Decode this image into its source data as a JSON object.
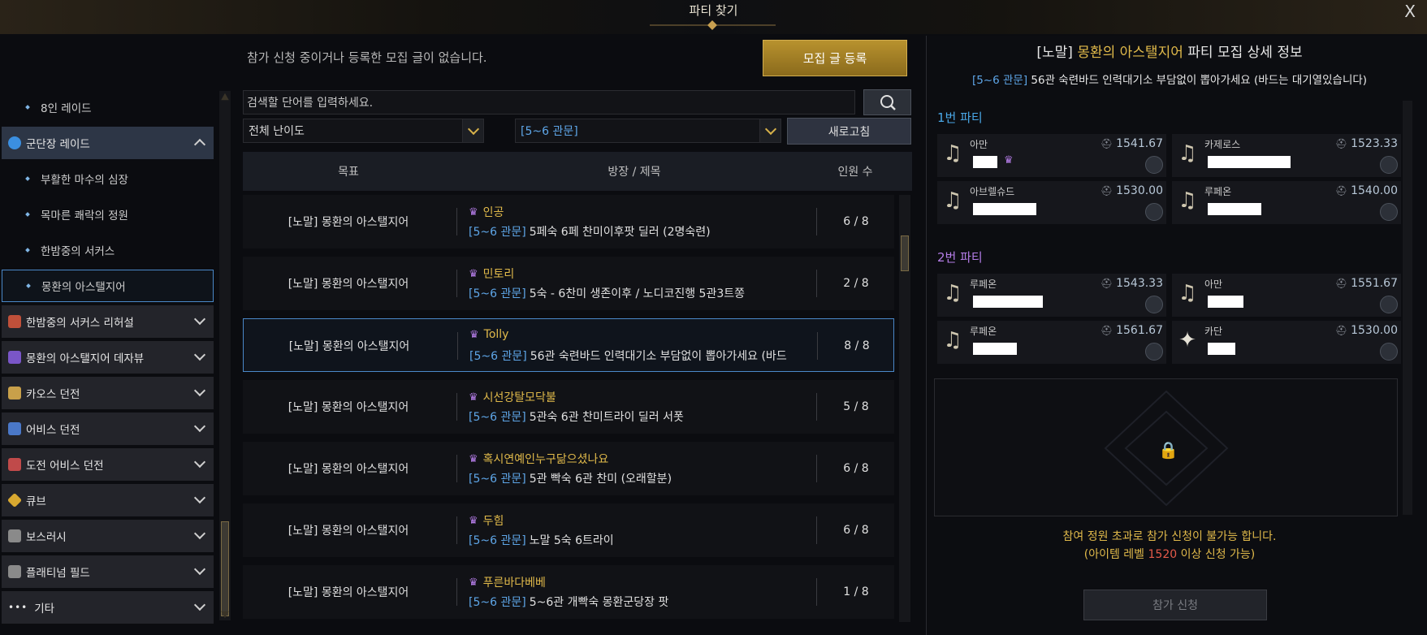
{
  "window": {
    "title": "파티 찾기",
    "close": "X"
  },
  "notice": "참가 신청 중이거나 등록한 모집 글이 없습니다.",
  "register_button": "모집 글 등록",
  "search": {
    "placeholder": "검색할 단어를 입력하세요."
  },
  "filters": {
    "difficulty": "전체 난이도",
    "gate": "[5~6 관문]",
    "refresh": "새로고침"
  },
  "sidebar": {
    "items": [
      {
        "label": "8인 레이드",
        "type": "sub"
      },
      {
        "label": "군단장 레이드",
        "type": "cat-open",
        "icon_color": "#3b8fe0"
      },
      {
        "label": "부활한 마수의 심장",
        "type": "sub"
      },
      {
        "label": "목마른 쾌락의 정원",
        "type": "sub"
      },
      {
        "label": "한밤중의 서커스",
        "type": "sub"
      },
      {
        "label": "몽환의 아스탤지어",
        "type": "sub-active"
      },
      {
        "label": "한밤중의 서커스 리허설",
        "type": "cat",
        "icon_color": "#c0503a"
      },
      {
        "label": "몽환의 아스탤지어 데자뷰",
        "type": "cat",
        "icon_color": "#7a56c8"
      },
      {
        "label": "카오스 던전",
        "type": "cat",
        "icon_color": "#c8a04a"
      },
      {
        "label": "어비스 던전",
        "type": "cat",
        "icon_color": "#4a78c8"
      },
      {
        "label": "도전 어비스 던전",
        "type": "cat",
        "icon_color": "#c04a4a"
      },
      {
        "label": "큐브",
        "type": "cat",
        "icon_color": "#d8a830"
      },
      {
        "label": "보스러시",
        "type": "cat",
        "icon_color": "#8a8a8a"
      },
      {
        "label": "플래티넘 필드",
        "type": "cat",
        "icon_color": "#8a8a8a"
      },
      {
        "label": "기타",
        "type": "cat",
        "icon_color": "#cfcfcf"
      }
    ]
  },
  "table": {
    "headers": {
      "goal": "목표",
      "leader_title": "방장 / 제목",
      "count": "인원 수"
    },
    "rows": [
      {
        "goal": "[노말] 몽환의 아스탤지어",
        "leader": "인공",
        "tag": "[5~6 관문]",
        "title": "5페숙 6페 찬미이후팟 딜러 (2명숙련)",
        "count": "6 / 8"
      },
      {
        "goal": "[노말] 몽환의 아스탤지어",
        "leader": "민토리",
        "tag": "[5~6 관문]",
        "title": "5숙 - 6찬미 생존이후 / 노디코진행 5관3트쫑",
        "count": "2 / 8"
      },
      {
        "goal": "[노말] 몽환의 아스탤지어",
        "leader": "Tolly",
        "tag": "[5~6 관문]",
        "title": "56관 숙련바드  인력대기소  부담없이 뽑아가세요 (바드",
        "count": "8 / 8"
      },
      {
        "goal": "[노말] 몽환의 아스탤지어",
        "leader": "시선강탈모닥불",
        "tag": "[5~6 관문]",
        "title": "5관숙 6관 찬미트라이 딜러 서폿",
        "count": "5 / 8"
      },
      {
        "goal": "[노말] 몽환의 아스탤지어",
        "leader": "혹시연예인누구닮으셨나요",
        "tag": "[5~6 관문]",
        "title": "5관 빡숙 6관 찬미 (오래할분)",
        "count": "6 / 8"
      },
      {
        "goal": "[노말] 몽환의 아스탤지어",
        "leader": "두힘",
        "tag": "[5~6 관문]",
        "title": "노말 5숙 6트라이",
        "count": "6 / 8"
      },
      {
        "goal": "[노말] 몽환의 아스탤지어",
        "leader": "푸른바다베베",
        "tag": "[5~6 관문]",
        "title": "5~6관 개빡숙 몽환군당장 팟",
        "count": "1 / 8"
      }
    ]
  },
  "detail": {
    "title_prefix": "[노말]",
    "raid": "몽환의 아스탤지어",
    "title_suffix": "파티 모집 상세 정보",
    "tag": "[5~6 관문]",
    "desc": "56관 숙련바드  인력대기소  부담없이 뽑아가세요 (바드는 대기열있습니다)",
    "party1": {
      "label": "1번 파티",
      "color": "#4aa8e8"
    },
    "party2": {
      "label": "2번 파티",
      "color": "#b57de8"
    },
    "members": [
      {
        "cls": "아만",
        "ilvl": "1541.67",
        "icon": "lyre-icon"
      },
      {
        "cls": "카제로스",
        "ilvl": "1523.33",
        "icon": "lyre-icon"
      },
      {
        "cls": "아브렐슈드",
        "ilvl": "1530.00",
        "icon": "lyre-icon"
      },
      {
        "cls": "루페온",
        "ilvl": "1540.00",
        "icon": "lyre-icon"
      },
      {
        "cls": "루페온",
        "ilvl": "1543.33",
        "icon": "lyre-icon"
      },
      {
        "cls": "아만",
        "ilvl": "1551.67",
        "icon": "lyre-icon"
      },
      {
        "cls": "루페온",
        "ilvl": "1561.67",
        "icon": "lyre-icon"
      },
      {
        "cls": "카단",
        "ilvl": "1530.00",
        "icon": "gunslinger-icon"
      }
    ],
    "warn_line1": "참여 정원 초과로 참가 신청이 불가능 합니다.",
    "warn_open": "(아이템 레벨 ",
    "warn_level": "1520",
    "warn_close": " 이상 신청 가능)",
    "apply": "참가 신청"
  }
}
